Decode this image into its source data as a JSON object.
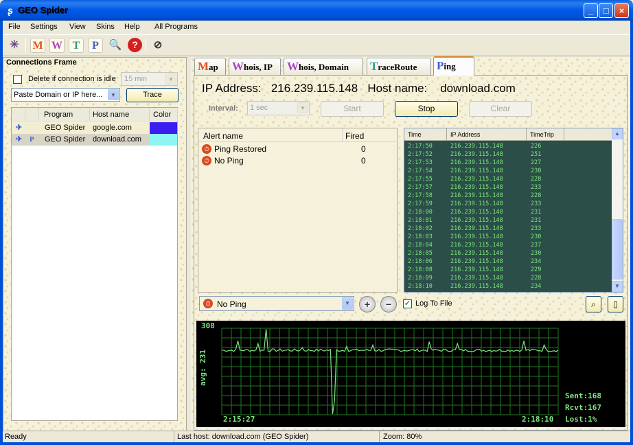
{
  "window": {
    "title": "GEO Spider",
    "icon": "spider-icon",
    "minimize": "_",
    "maximize": "□",
    "close": "×"
  },
  "menu": [
    "File",
    "Settings",
    "View",
    "Skins",
    "Help",
    "All Programs"
  ],
  "toolbar": {
    "icons": [
      "spider-icon",
      "map-m-icon",
      "whois-w-icon",
      "traceroute-t-icon",
      "ping-p-icon",
      "search-icon",
      "help-icon",
      "antispy-icon"
    ],
    "letters": {
      "m": "M",
      "w": "W",
      "t": "T",
      "p": "P"
    }
  },
  "connections": {
    "title": "Connections Frame",
    "delete_label": "Delete if connection is idle",
    "idle_value": "15 min",
    "input_value": "Paste Domain or IP here...",
    "trace_label": "Trace",
    "columns": [
      "Program",
      "Host name",
      "Color"
    ],
    "rows": [
      {
        "program": "GEO Spider",
        "host": "google.com",
        "color": "#3a1ff0",
        "icon2": ""
      },
      {
        "program": "GEO Spider",
        "host": "download.com",
        "color": "#8ef5f5",
        "icon2": "P"
      }
    ]
  },
  "tabs": [
    {
      "letter": "M",
      "label": "ap"
    },
    {
      "letter": "W",
      "label": "hois, IP"
    },
    {
      "letter": "W",
      "label": "hois, Domain"
    },
    {
      "letter": "T",
      "label": "raceRoute"
    },
    {
      "letter": "P",
      "label": "ing"
    }
  ],
  "ping": {
    "ip_label": "IP Address:",
    "ip_value": "216.239.115.148",
    "host_label": "Host name:",
    "host_value": "download.com",
    "interval_label": "Interval:",
    "interval_value": "1 sec",
    "start": "Start",
    "stop": "Stop",
    "clear": "Clear",
    "alert_cols": [
      "Alert name",
      "Fired"
    ],
    "alerts": [
      {
        "name": "Ping Restored",
        "fired": "0"
      },
      {
        "name": "No Ping",
        "fired": "0"
      }
    ],
    "log_cols": [
      "Time",
      "IP Address",
      "TimeTrip"
    ],
    "log": [
      [
        "2:17:50",
        "216.239.115.148",
        "226"
      ],
      [
        "2:17:52",
        "216.239.115.148",
        "251"
      ],
      [
        "2:17:53",
        "216.239.115.148",
        "227"
      ],
      [
        "2:17:54",
        "216.239.115.148",
        "230"
      ],
      [
        "2:17:55",
        "216.239.115.148",
        "228"
      ],
      [
        "2:17:57",
        "216.239.115.148",
        "233"
      ],
      [
        "2:17:58",
        "216.239.115.148",
        "228"
      ],
      [
        "2:17:59",
        "216.239.115.148",
        "233"
      ],
      [
        "2:18:00",
        "216.239.115.148",
        "231"
      ],
      [
        "2:18:01",
        "216.239.115.148",
        "231"
      ],
      [
        "2:18:02",
        "216.239.115.148",
        "233"
      ],
      [
        "2:18:03",
        "216.239.115.148",
        "230"
      ],
      [
        "2:18:04",
        "216.239.115.148",
        "237"
      ],
      [
        "2:18:05",
        "216.239.115.148",
        "230"
      ],
      [
        "2:18:06",
        "216.239.115.148",
        "234"
      ],
      [
        "2:18:08",
        "216.239.115.148",
        "229"
      ],
      [
        "2:18:09",
        "216.239.115.148",
        "228"
      ],
      [
        "2:18:10",
        "216.239.115.148",
        "234"
      ]
    ],
    "alert_select": "No Ping",
    "log_to_file": "Log To File",
    "graph": {
      "max": "308",
      "avg": "avg: 231",
      "start": "2:15:27",
      "end": "2:18:10",
      "sent": "Sent:168",
      "rcvt": "Rcvt:167",
      "lost": "Lost:1%"
    }
  },
  "status": {
    "ready": "Ready",
    "last_host": "Last host: download.com (GEO Spider)",
    "zoom": "Zoom: 80%"
  },
  "colors": {
    "accent": "#0058e6",
    "graph_line": "#7ee87e",
    "graph_grid": "#1f7a1f"
  }
}
